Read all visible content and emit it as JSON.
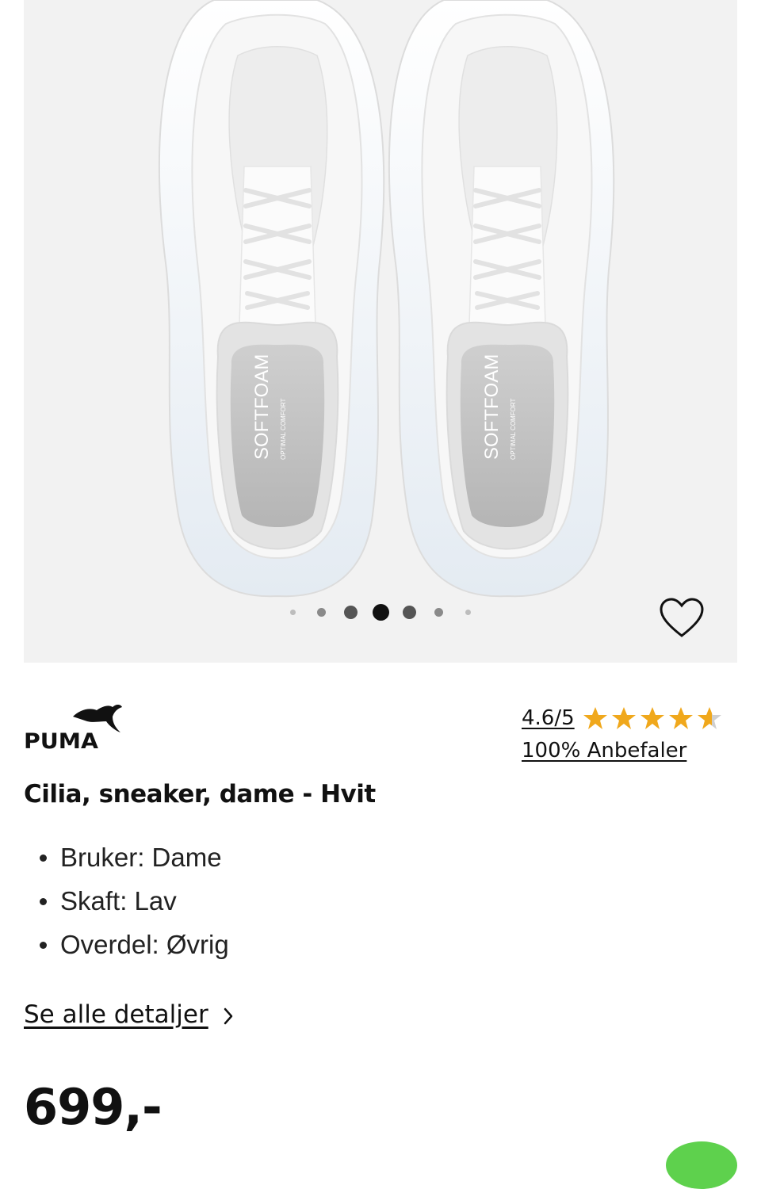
{
  "gallery": {
    "dot_count": 7,
    "active_dot": 3,
    "insole_text": "SOFTFOAM",
    "insole_subtext": "OPTIMAL COMFORT"
  },
  "brand": {
    "name": "PUMA"
  },
  "rating": {
    "score": "4.6/5",
    "stars": 4.6,
    "star_color": "#f0a81c",
    "recommend": "100% Anbefaler"
  },
  "product": {
    "title": "Cilia, sneaker, dame - Hvit",
    "specs": [
      {
        "text": "Bruker: Dame"
      },
      {
        "text": "Skaft: Lav"
      },
      {
        "text": "Overdel: Øvrig"
      }
    ],
    "details_link": "Se alle detaljer",
    "price": "699,-"
  },
  "icons": [
    "heart-icon",
    "chevron-right-icon",
    "star-icon",
    "puma-cat-icon"
  ]
}
